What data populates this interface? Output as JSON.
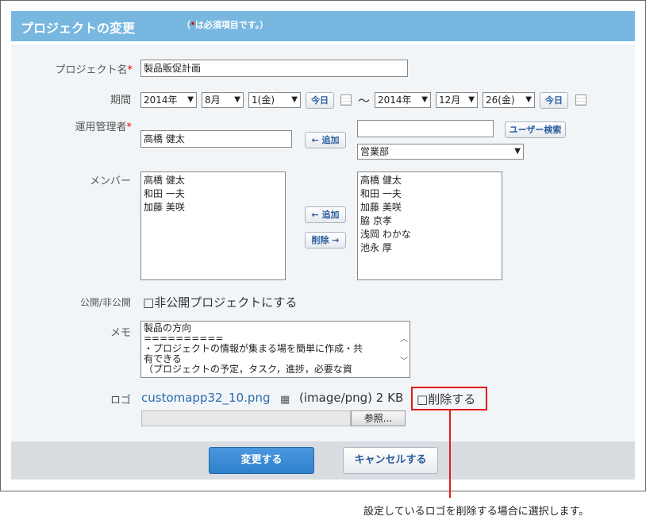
{
  "title": "プロジェクトの変更",
  "required_note": {
    "open": "（",
    "mark": "*",
    "text": "は必須項目です。）"
  },
  "fields": {
    "project_name": {
      "label": "プロジェクト名",
      "req": "*",
      "value": "製品販促計画"
    },
    "period": {
      "label": "期間",
      "start": {
        "year": "2014年",
        "month": "8月",
        "day": "1(金)"
      },
      "end": {
        "year": "2014年",
        "month": "12月",
        "day": "26(金)"
      },
      "today_label": "今日",
      "tilde": "～"
    },
    "manager": {
      "label": "運用管理者",
      "req": "*",
      "value": "高橋 健太",
      "add_label": "← 追加",
      "search_value": "",
      "user_search_label": "ユーザー検索",
      "dept": "営業部"
    },
    "members": {
      "label": "メンバー",
      "selected": [
        "高橋 健太",
        "和田 一夫",
        "加藤 美咲"
      ],
      "candidates": [
        "高橋 健太",
        "和田 一夫",
        "加藤 美咲",
        "脇 京孝",
        "浅岡 わかな",
        "池永 厚"
      ],
      "add_label": "← 追加",
      "remove_label": "削除 →"
    },
    "visibility": {
      "label": "公開/非公開",
      "checkbox": "□",
      "option": "非公開プロジェクトにする"
    },
    "memo": {
      "label": "メモ",
      "lines": [
        "製品の方向",
        "==========",
        "・プロジェクトの情報が集まる場を簡単に作成・共",
        "有できる",
        "（プロジェクトの予定，タスク，進捗，必要な資"
      ]
    },
    "logo": {
      "label": "ロゴ",
      "filename": "customapp32_10.png",
      "info": "(image/png) 2 KB",
      "delete_checkbox": "□",
      "delete_label": "削除する",
      "browse_label": "参照..."
    }
  },
  "buttons": {
    "save": "変更する",
    "cancel": "キャンセルする"
  },
  "annotation": "設定しているロゴを削除する場合に選択します。",
  "colors": {
    "header": "#77b7e0",
    "primary_button": "#2f80cc",
    "callout": "#e31b1b"
  }
}
